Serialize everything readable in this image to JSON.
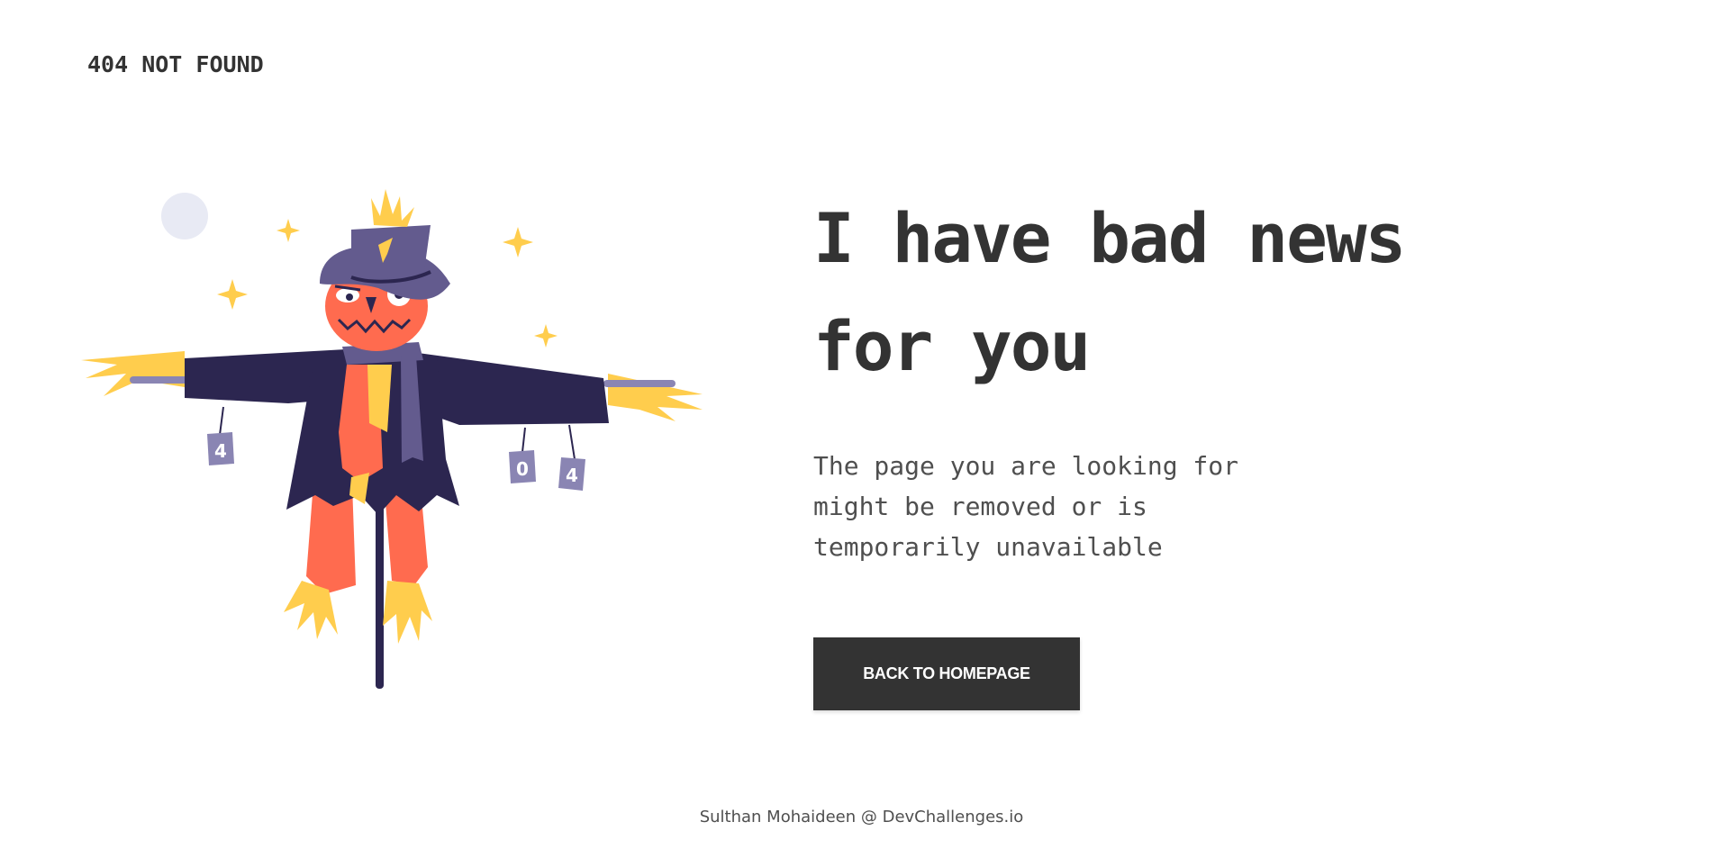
{
  "header": {
    "brand": "404 NOT FOUND"
  },
  "illustration": {
    "alt": "scarecrow",
    "cans": [
      "4",
      "0",
      "4"
    ]
  },
  "main": {
    "headline_line1": "I have bad news",
    "headline_line2": "for you",
    "subtext_line1": "The page you are looking for",
    "subtext_line2": "might be removed or is",
    "subtext_line3": "temporarily unavailable",
    "button_label": "BACK TO HOMEPAGE"
  },
  "footer": {
    "credit": "Sulthan Mohaideen @ DevChallenges.io"
  },
  "colors": {
    "text": "#333333",
    "button_bg": "#333333",
    "button_text": "#ffffff",
    "hat": "#635b8e",
    "coat": "#2c2650",
    "face": "#ff6b4f",
    "straw": "#ffcd4d",
    "moon": "#e8eaf4"
  }
}
